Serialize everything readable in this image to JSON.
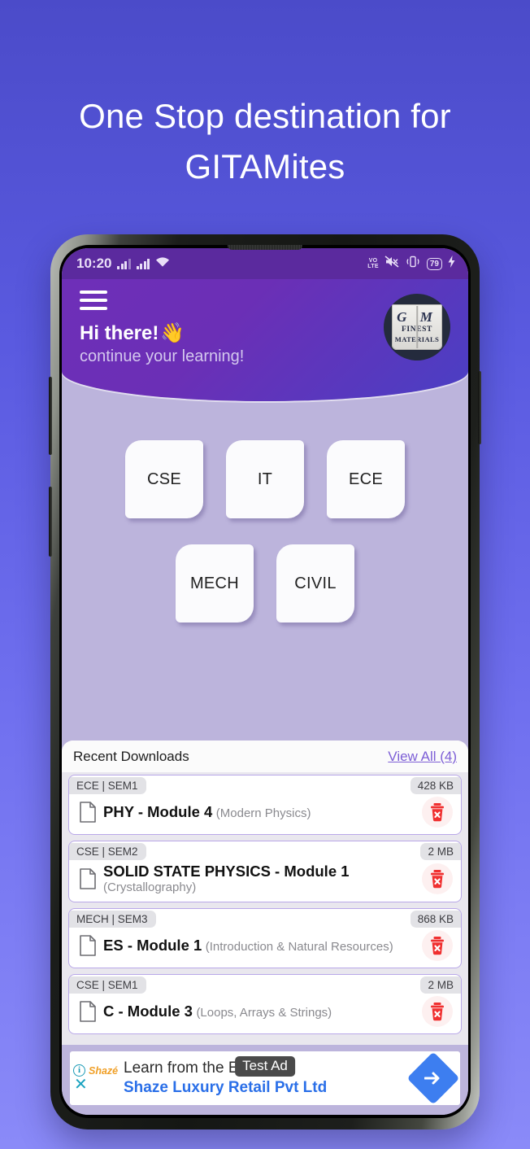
{
  "promo": {
    "line1": "One Stop destination for",
    "line2": "GITAMites"
  },
  "theme": {
    "bg_top": "#4b4bc9",
    "bg_bottom": "#8a8af8",
    "header_purple": "#6b2fb6",
    "body_lavender": "#bcb4dc",
    "accent_link": "#7d5fd6",
    "delete_red": "#f03030",
    "ad_blue": "#2a6fe8"
  },
  "statusbar": {
    "time": "10:20",
    "volte": "VO",
    "volte2": "LTE",
    "battery": "79",
    "icons": [
      "signal-bars-icon",
      "signal-bars-icon",
      "wifi-icon",
      "volte-icon",
      "mute-icon",
      "vibrate-icon",
      "battery-icon",
      "charging-bolt-icon"
    ]
  },
  "header": {
    "menu_icon": "hamburger-menu-icon",
    "greeting": "Hi there!",
    "greeting_emoji": "👋",
    "subtitle": "continue your learning!",
    "logo": {
      "line1": "G M",
      "line2": "FINEST",
      "line3": "MATERIALS"
    }
  },
  "departments": {
    "row1": [
      {
        "label": "CSE"
      },
      {
        "label": "IT"
      },
      {
        "label": "ECE"
      }
    ],
    "row2": [
      {
        "label": "MECH"
      },
      {
        "label": "CIVIL"
      }
    ]
  },
  "recent": {
    "title": "Recent Downloads",
    "view_all": "View All (4)",
    "items": [
      {
        "chip": "ECE | SEM1",
        "size": "428 KB",
        "name": "PHY - Module 4",
        "subtitle": "(Modern Physics)"
      },
      {
        "chip": "CSE | SEM2",
        "size": "2 MB",
        "name": "SOLID STATE PHYSICS - Module 1",
        "subtitle": "(Crystallography)"
      },
      {
        "chip": "MECH | SEM3",
        "size": "868 KB",
        "name": "ES - Module 1",
        "subtitle": "(Introduction & Natural Resources)"
      },
      {
        "chip": "CSE | SEM1",
        "size": "2 MB",
        "name": "C - Module 3",
        "subtitle": "(Loops, Arrays & Strings)"
      }
    ]
  },
  "ad": {
    "badge": "Test Ad",
    "brand": "Shazé",
    "info_glyph": "i",
    "close_glyph": "✕",
    "headline": "Learn from the Experts",
    "advertiser": "Shaze Luxury Retail Pvt Ltd"
  }
}
